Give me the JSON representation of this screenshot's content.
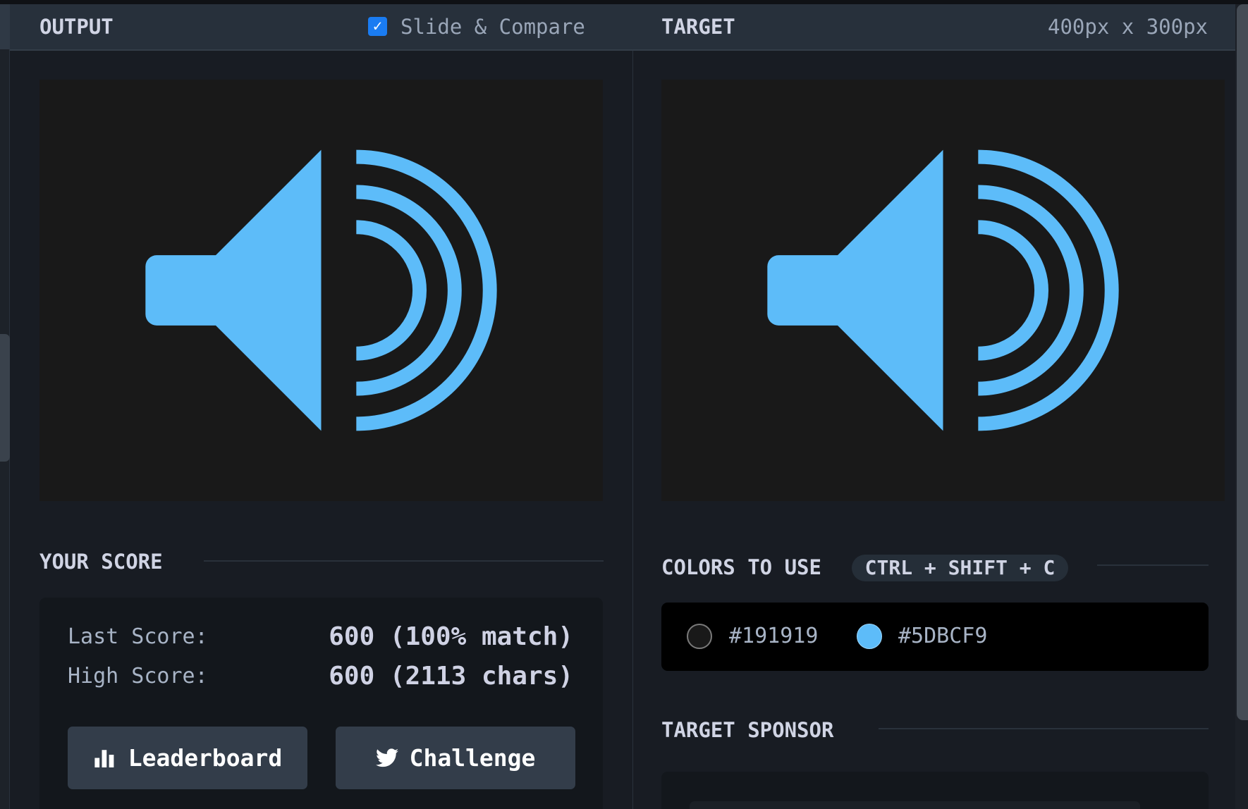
{
  "header": {
    "output_title": "OUTPUT",
    "slide_compare_label": "Slide & Compare",
    "slide_compare_checked": true,
    "target_title": "TARGET",
    "dimensions": "400px x 300px"
  },
  "score": {
    "title": "YOUR SCORE",
    "last_label": "Last Score:",
    "last_value": "600 (100% match)",
    "high_label": "High Score:",
    "high_value": "600 (2113 chars)",
    "leaderboard_label": "Leaderboard",
    "challenge_label": "Challenge"
  },
  "colors": {
    "title": "COLORS TO USE",
    "shortcut": "CTRL + SHIFT + C",
    "items": [
      {
        "hex": "#191919",
        "color": "#191919"
      },
      {
        "hex": "#5DBCF9",
        "color": "#5DBCF9"
      }
    ]
  },
  "sponsor": {
    "title": "TARGET SPONSOR"
  },
  "icons": {
    "checkbox": "checkmark-icon",
    "leaderboard": "bar-chart-icon",
    "challenge": "twitter-bird-icon",
    "canvas": "speaker-volume-icon"
  }
}
